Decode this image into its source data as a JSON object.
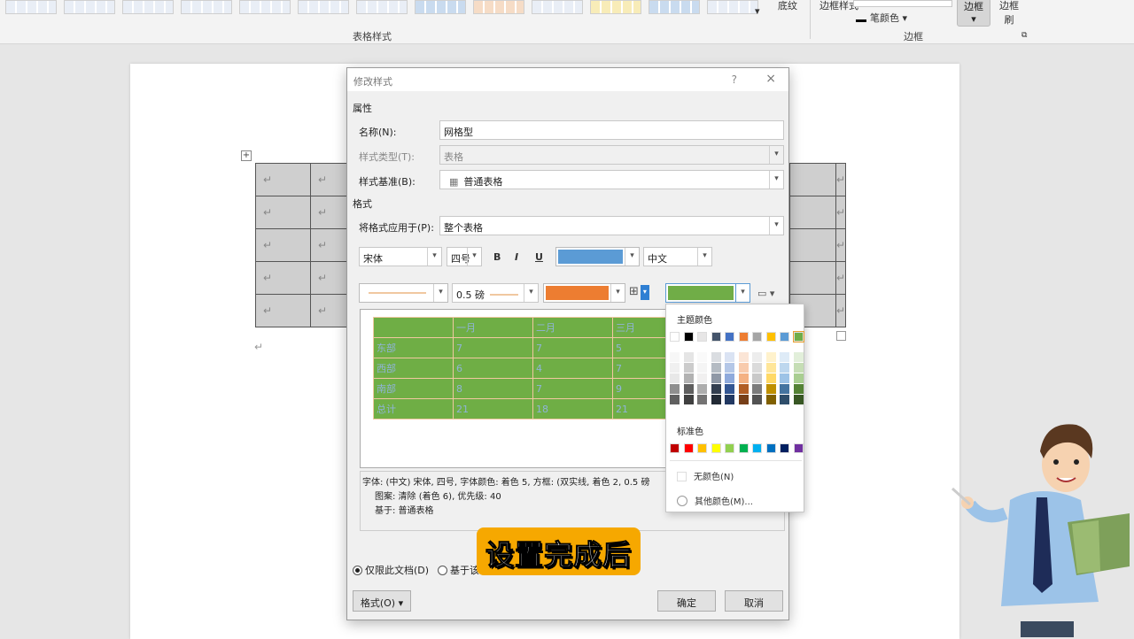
{
  "ribbon": {
    "table_styles_label": "表格样式",
    "shading_label": "底纹",
    "border_styles_label": "边框样式",
    "pen_color_label": "笔颜色",
    "borders_button_label": "边框",
    "border_painter_label": "边框刷",
    "borders_group_label": "边框"
  },
  "dialog": {
    "title": "修改样式",
    "help": "?",
    "close": "×",
    "properties_section": "属性",
    "name_label": "名称(N):",
    "name_value": "网格型",
    "style_type_label": "样式类型(T):",
    "style_type_value": "表格",
    "based_on_label": "样式基准(B):",
    "based_on_value": "普通表格",
    "format_section": "格式",
    "apply_to_label": "将格式应用于(P):",
    "apply_to_value": "整个表格",
    "font": "宋体",
    "font_size": "四号",
    "bold": "B",
    "italic": "I",
    "underline": "U",
    "script": "中文",
    "border_width": "0.5 磅",
    "description_line1": "字体: (中文) 宋体, 四号, 字体颜色: 着色 5, 方框: (双实线, 着色 2,  0.5 磅",
    "description_line2": "图案: 清除 (着色 6), 优先级: 40",
    "description_line3": "基于: 普通表格",
    "radio_this_doc": "仅限此文档(D)",
    "radio_template": "基于该",
    "format_button": "格式(O) ▾",
    "ok_button": "确定",
    "cancel_button": "取消"
  },
  "palette": {
    "theme_colors_title": "主题颜色",
    "standard_colors_title": "标准色",
    "no_color": "无颜色(N)",
    "more_colors": "其他颜色(M)..."
  },
  "subtitle": "设置完成后",
  "colors": {
    "font_color": "#5b9bd5",
    "border_color": "#ed7d31",
    "shading_color": "#70ad47",
    "theme_row": [
      "#ffffff",
      "#000000",
      "#e7e6e6",
      "#44546a",
      "#4472c4",
      "#ed7d31",
      "#a5a5a5",
      "#ffc000",
      "#5b9bd5",
      "#70ad47"
    ],
    "standard_row": [
      "#c00000",
      "#ff0000",
      "#ffc000",
      "#ffff00",
      "#92d050",
      "#00b050",
      "#00b0f0",
      "#0070c0",
      "#002060",
      "#7030a0"
    ]
  }
}
